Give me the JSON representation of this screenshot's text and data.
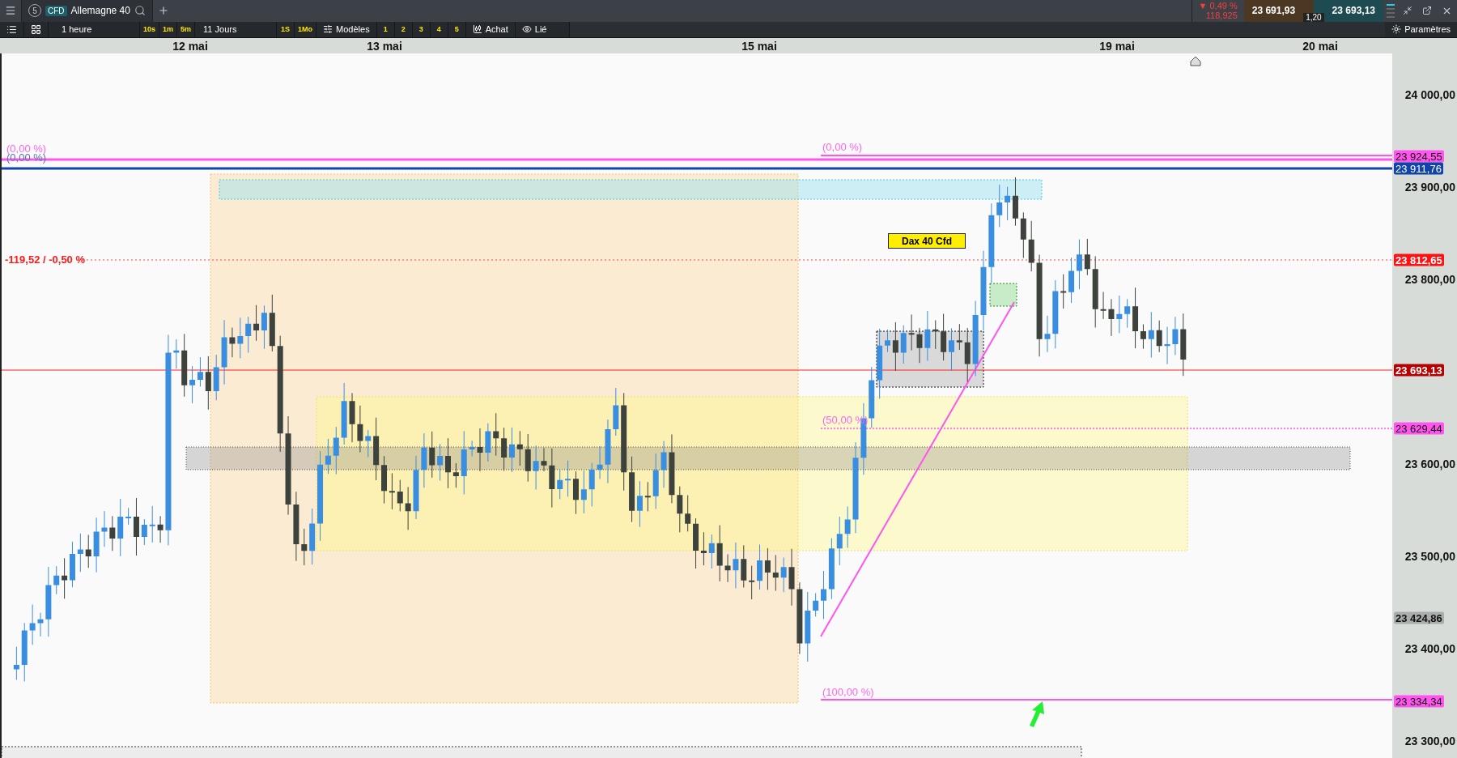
{
  "top_bar": {
    "tab_count": "5",
    "badge": "CFD",
    "instrument": "Allemagne 40",
    "change": "▼ 0,49 %",
    "change_points": "118,925",
    "sell": "23 691,93",
    "buy": "23 693,13",
    "spread": "1,20"
  },
  "toolbar": {
    "interval": "1 heure",
    "quick_intervals": [
      "10s",
      "1m",
      "5m"
    ],
    "range": "11 Jours",
    "quick_ranges": [
      "1S",
      "1Mo"
    ],
    "templates": "Modèles",
    "layouts": [
      "1",
      "2",
      "3",
      "4",
      "5"
    ],
    "trade": "Achat",
    "linked": "Lié",
    "settings": "Paramètres"
  },
  "dates": [
    "12 mai",
    "13 mai",
    "15 mai",
    "19 mai",
    "20 mai"
  ],
  "chart": {
    "labels": [
      {
        "text": "(0,00 %)",
        "color": "#ff66ee"
      },
      {
        "text": "(0,00 %)",
        "color": "#5577aa"
      },
      {
        "text": "-119,52 / -0,50 %",
        "color": "#ff1a1a"
      },
      {
        "text": "(0,00 %)",
        "color": "#ff66ee"
      },
      {
        "text": "(50,00 %)",
        "color": "#ff66ee"
      },
      {
        "text": "(100,00 %)",
        "color": "#ff66ee"
      }
    ],
    "flag": "Dax 40 Cfd"
  },
  "price_axis": {
    "ticks": [
      "24 000,00",
      "23 900,00",
      "23 800,00",
      "23 600,00",
      "23 500,00",
      "23 400,00",
      "23 300,00"
    ],
    "tags": [
      {
        "text": "23 924,55",
        "color": "#ff55ee"
      },
      {
        "text": "23 911,76",
        "color": "#1144aa"
      },
      {
        "text": "23 812,65",
        "color": "#ff1111"
      },
      {
        "text": "23 693,13",
        "color": "#b80000"
      },
      {
        "text": "23 629,44",
        "color": "#ff55ee"
      },
      {
        "text": "23 424,86",
        "color": "#a9adab"
      },
      {
        "text": "23 334,34",
        "color": "#ff55ee"
      }
    ]
  }
}
